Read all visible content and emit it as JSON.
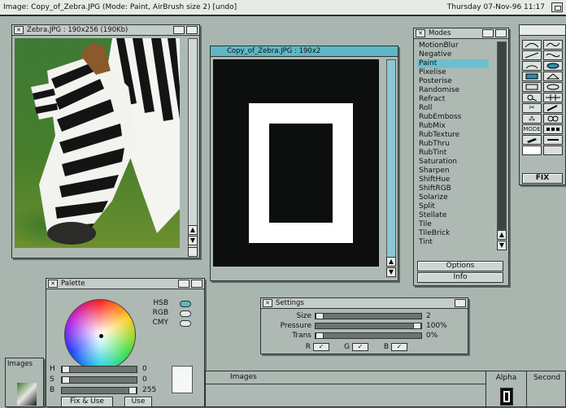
{
  "screen": {
    "title": "Image: Copy_of_Zebra.JPG (Mode: Paint, AirBrush size 2) [undo]",
    "clock": "Thursday 07-Nov-96 11:17"
  },
  "zebra_window": {
    "title": "Zebra.JPG : 190x256 (190Kb)"
  },
  "canvas_window": {
    "title": "Copy_of_Zebra.JPG : 190x2"
  },
  "modes_window": {
    "title": "Modes",
    "items": [
      "MotionBlur",
      "Negative",
      "Paint",
      "Pixelise",
      "Posterise",
      "Randomise",
      "Refract",
      "Roll",
      "RubEmboss",
      "RubMix",
      "RubTexture",
      "RubThru",
      "RubTint",
      "Saturation",
      "Sharpen",
      "ShiftHue",
      "ShiftRGB",
      "Solarize",
      "Split",
      "Stellate",
      "Tile",
      "TileBrick",
      "Tint"
    ],
    "selected": "Paint",
    "options_label": "Options",
    "info_label": "Info"
  },
  "toolbox": {
    "fix_label": "FIX",
    "mode_label": "MODE"
  },
  "palette_window": {
    "title": "Palette",
    "modes": [
      "HSB",
      "RGB",
      "CMY"
    ],
    "active_mode": "HSB",
    "sliders": [
      {
        "label": "H",
        "value": "0"
      },
      {
        "label": "S",
        "value": "0"
      },
      {
        "label": "B",
        "value": "255"
      }
    ],
    "fix_use_label": "Fix & Use",
    "use_label": "Use"
  },
  "settings_window": {
    "title": "Settings",
    "rows": [
      {
        "label": "Size",
        "value": "2"
      },
      {
        "label": "Pressure",
        "value": "100%"
      },
      {
        "label": "Trans",
        "value": "0%"
      }
    ],
    "channels": [
      "R",
      "G",
      "B"
    ]
  },
  "images_bar": {
    "left_label": "Images",
    "center_label": "Images",
    "alpha_label": "Alpha",
    "second_label": "Second"
  },
  "colors": {
    "accent": "#5fb7c6",
    "desktop": "#a9b6b0",
    "canvas": "#0c0f0e"
  }
}
